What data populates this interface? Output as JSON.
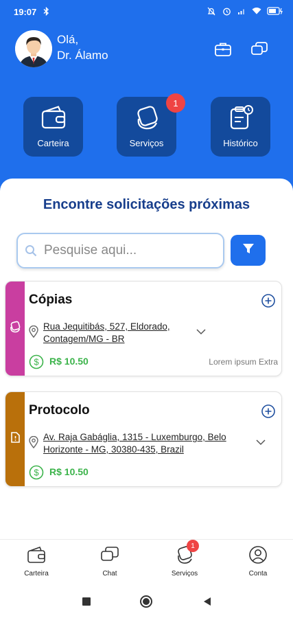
{
  "status_bar": {
    "time": "19:07",
    "icons": [
      "bluetooth-icon",
      "mute-icon",
      "alarm-icon",
      "signal-icon",
      "wifi-icon",
      "battery-icon"
    ]
  },
  "header": {
    "greeting": "Olá,",
    "user_name": "Dr. Álamo",
    "icons": [
      "briefcase-icon",
      "chat-icon"
    ]
  },
  "tiles": [
    {
      "label": "Carteira",
      "icon": "wallet-icon"
    },
    {
      "label": "Serviços",
      "icon": "services-icon",
      "badge": "1"
    },
    {
      "label": "Histórico",
      "icon": "history-icon"
    }
  ],
  "main": {
    "title": "Encontre solicitações próximas",
    "search_placeholder": "Pesquise aqui..."
  },
  "requests": [
    {
      "title": "Cópias",
      "address": "Rua Jequitibás, 527, Eldorado, Contagem/MG - BR",
      "price": "R$ 10.50",
      "extra": "Lorem ipsum Extra",
      "color": "#c93ea0",
      "icon": "copies-icon"
    },
    {
      "title": "Protocolo",
      "address": "Av. Raja Gabáglia, 1315 - Luxemburgo, Belo Horizonte - MG, 30380-435, Brazil",
      "price": "R$ 10.50",
      "color": "#b9700b",
      "icon": "document-icon"
    }
  ],
  "bottom_nav": [
    {
      "label": "Carteira",
      "icon": "wallet-icon"
    },
    {
      "label": "Chat",
      "icon": "chat-icon"
    },
    {
      "label": "Serviços",
      "icon": "services-icon",
      "badge": "1"
    },
    {
      "label": "Conta",
      "icon": "account-icon"
    }
  ],
  "colors": {
    "primary": "#1f6fec",
    "tile": "#134a9c",
    "title": "#173e8c",
    "price": "#3bb34a",
    "badge": "#ef4444"
  }
}
